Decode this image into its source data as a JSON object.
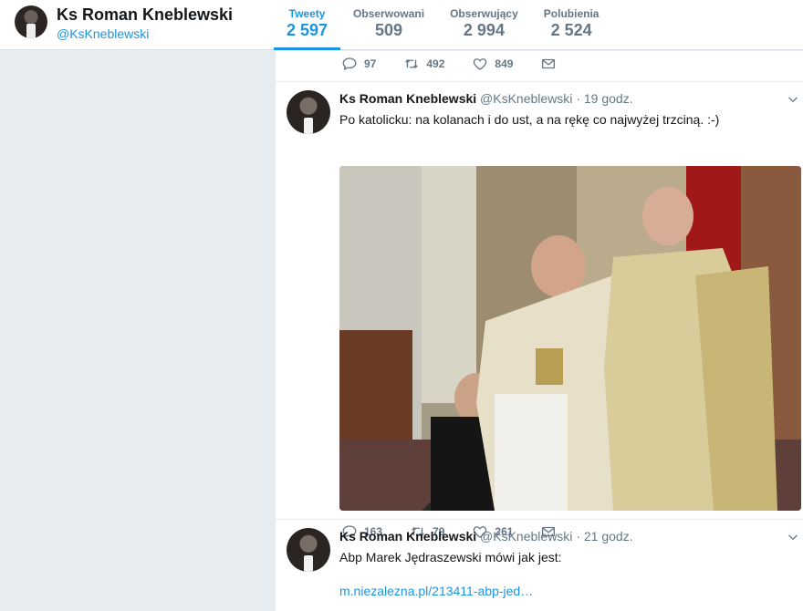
{
  "profile": {
    "name": "Ks Roman Kneblewski",
    "handle": "@KsKneblewski"
  },
  "nav": {
    "items": [
      {
        "label": "Tweety",
        "value": "2 597",
        "active": true
      },
      {
        "label": "Obserwowani",
        "value": "509",
        "active": false
      },
      {
        "label": "Obserwujący",
        "value": "2 994",
        "active": false
      },
      {
        "label": "Polubienia",
        "value": "2 524",
        "active": false
      }
    ]
  },
  "prev_tweet": {
    "replies": "97",
    "retweets": "492",
    "likes": "849"
  },
  "tweets": [
    {
      "name": "Ks Roman Kneblewski",
      "handle": "@KsKneblewski",
      "separator": "·",
      "time": "19 godz.",
      "text": "Po katolicku: na kolanach i do ust, a na rękę co najwyżej trzciną.  :-)",
      "replies": "163",
      "retweets": "79",
      "likes": "261"
    },
    {
      "name": "Ks Roman Kneblewski",
      "handle": "@KsKneblewski",
      "separator": "·",
      "time": "21 godz.",
      "text": "Abp Marek Jędraszewski mówi jak jest:",
      "link": "m.niezalezna.pl/213411-abp-jed…"
    }
  ],
  "colors": {
    "accent": "#1b95e0",
    "muted": "#657786",
    "background": "#e6ecf0"
  },
  "icons": {
    "reply": "speech-bubble",
    "retweet": "retweet-arrows",
    "like": "heart-outline",
    "dm": "envelope",
    "caret": "chevron-down"
  }
}
